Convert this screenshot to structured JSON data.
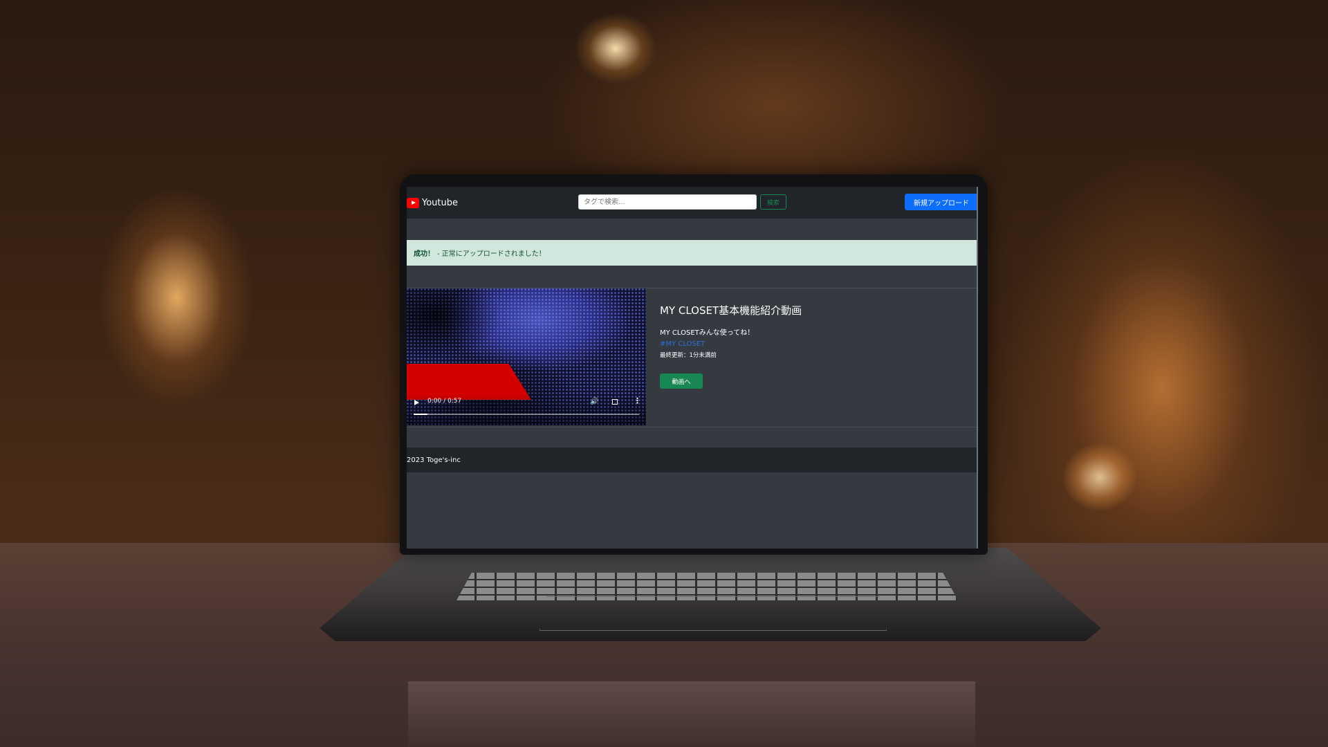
{
  "app": {
    "brand": "Youtube"
  },
  "header": {
    "search_placeholder": "タグで検索...",
    "search_button": "検索",
    "upload_button": "新規アップロード"
  },
  "alert": {
    "strong": "成功！",
    "message": "- 正常にアップロードされました！"
  },
  "video": {
    "title": "MY CLOSET基本機能紹介動画",
    "description": "MY CLOSETみんな使ってね！",
    "tag": "#MY CLOSET",
    "updated": "最終更新：1分未満前",
    "button": "動画へ",
    "player": {
      "time": "0:00 / 0:57",
      "progress": 0.06
    }
  },
  "footer": {
    "text": "2023 Toge's-inc"
  },
  "colors": {
    "navbar": "#212529",
    "page_bg": "#343a40",
    "primary": "#0d6efd",
    "success": "#198754",
    "alert_bg": "#d1e7dd",
    "alert_text": "#0f5132",
    "link": "#2f6fd6"
  }
}
